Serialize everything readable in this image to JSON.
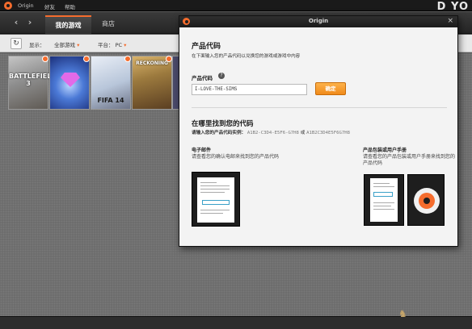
{
  "titlebar": {
    "app_name": "Origin",
    "menu": [
      "好友",
      "帮助"
    ]
  },
  "nav": {
    "back": "‹",
    "forward": "›",
    "tabs": [
      {
        "label": "我的游戏",
        "active": true
      },
      {
        "label": "商店",
        "active": false
      }
    ]
  },
  "filters": {
    "refresh": "↻",
    "show_label": "显示：",
    "show_value": "全部游戏",
    "platform_label": "平台：",
    "platform_value": "PC",
    "caret": "▾"
  },
  "games": [
    {
      "label": "BATTLEFIELD 3"
    },
    {
      "label": ""
    },
    {
      "label": "FIFA 14"
    },
    {
      "label": "RECKONING"
    }
  ],
  "dialog": {
    "title": "Origin",
    "close": "×",
    "heading": "产品代码",
    "subtitle": "在下面输入您的产品代码以兑换您的游戏或游戏中内容",
    "code_label": "产品代码",
    "help": "?",
    "code_value": "I-LOVE-THE-SIMS",
    "confirm_button": "确定",
    "where_heading": "在哪里找到您的代码",
    "example_label": "请输入您的产品代码实例：",
    "example_code_1": "A1B2-C3D4-E5F6-G7H8",
    "example_or": "或",
    "example_code_2": "A1B2C3D4E5F6G7H8",
    "email_title": "电子邮件",
    "email_desc": "请查看您的确认电邮来找到您的产品代码",
    "retail_title": "产品包装或用户手册",
    "retail_desc": "请查看您的产品包装或用户手册来找到您的产品代码"
  },
  "watermark": {
    "brand": "D YO",
    "mascot": "♞"
  },
  "colors": {
    "accent": "#f56c2d",
    "confirm": "#f5a02a"
  }
}
